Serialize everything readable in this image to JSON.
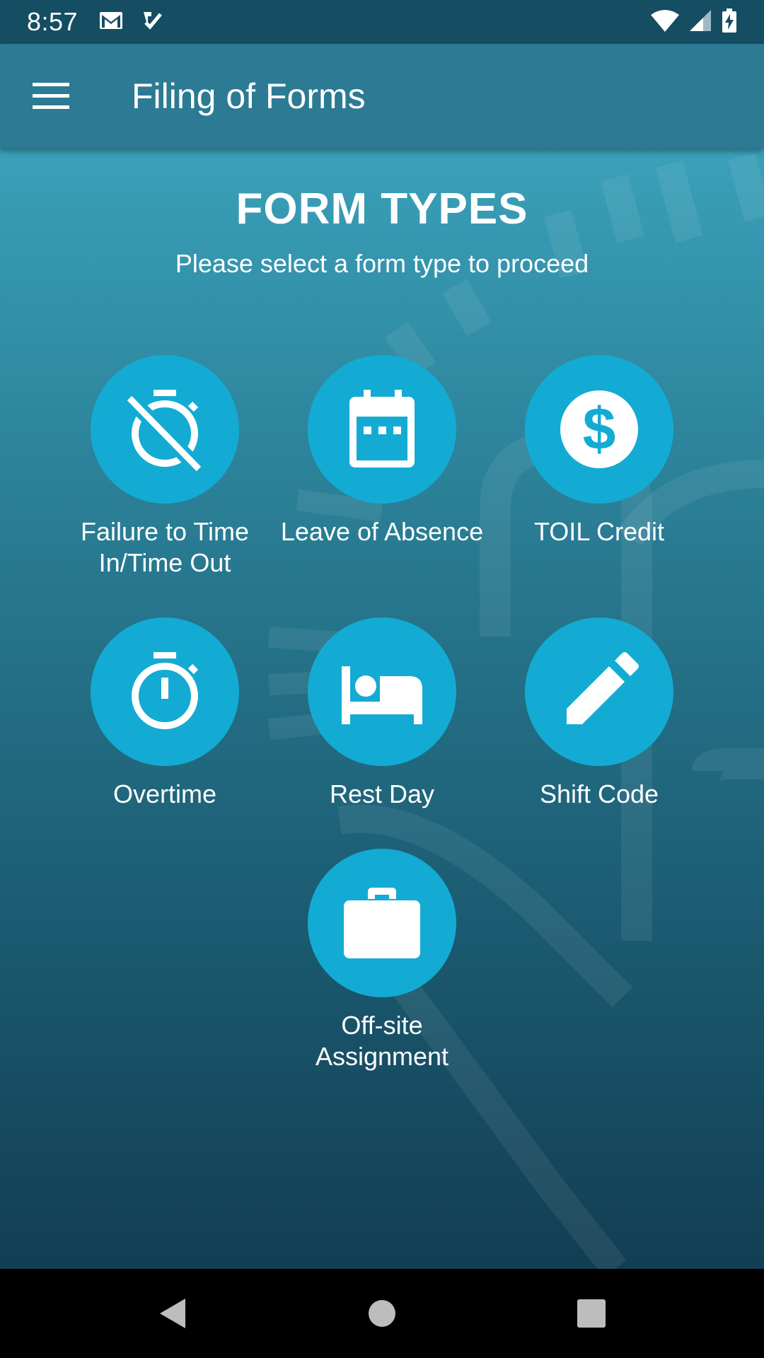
{
  "status_bar": {
    "time": "8:57",
    "left_icons": [
      "gmail-icon",
      "task-icon"
    ],
    "right_icons": [
      "wifi-icon",
      "cell-signal-icon",
      "battery-charging-icon"
    ]
  },
  "app_bar": {
    "menu_icon": "hamburger-menu-icon",
    "title": "Filing of Forms"
  },
  "main": {
    "heading": "FORM TYPES",
    "subheading": "Please select a form type to proceed",
    "accent_color": "#13abd3",
    "form_types": [
      {
        "label": "Failure to Time In/Time Out",
        "icon": "timer-off-icon"
      },
      {
        "label": "Leave of Absence",
        "icon": "calendar-icon"
      },
      {
        "label": "TOIL Credit",
        "icon": "dollar-icon"
      },
      {
        "label": "Overtime",
        "icon": "timer-icon"
      },
      {
        "label": "Rest Day",
        "icon": "bed-icon"
      },
      {
        "label": "Shift Code",
        "icon": "pencil-icon"
      },
      {
        "label": "Off-site Assignment",
        "icon": "briefcase-icon"
      }
    ]
  },
  "nav_bar": {
    "buttons": [
      "back-icon",
      "home-icon",
      "recents-icon"
    ]
  }
}
